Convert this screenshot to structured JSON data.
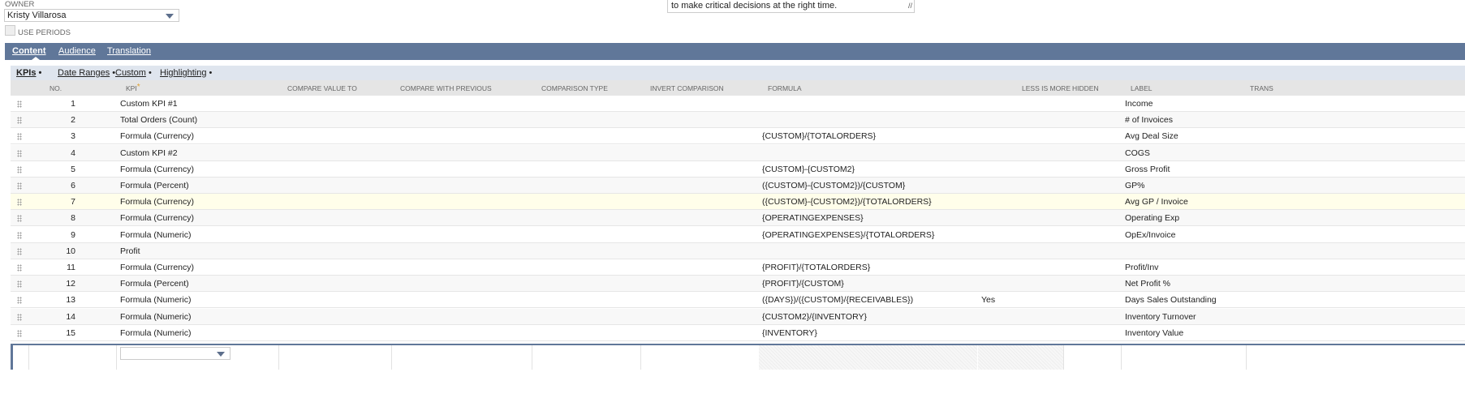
{
  "owner": {
    "label": "OWNER",
    "value": "Kristy Villarosa"
  },
  "use_periods": {
    "label": "USE PERIODS",
    "checked": false
  },
  "description": {
    "visible_text": "to make critical decisions at the right time."
  },
  "tabs": [
    {
      "label": "Content",
      "active": true
    },
    {
      "label": "Audience",
      "active": false
    },
    {
      "label": "Translation",
      "active": false
    }
  ],
  "subtabs": [
    {
      "label": "KPIs",
      "active": true
    },
    {
      "label": "Date Ranges",
      "active": false
    },
    {
      "label": "Custom",
      "active": false
    },
    {
      "label": "Highlighting",
      "active": false
    }
  ],
  "table": {
    "columns": {
      "no": "NO.",
      "kpi": "KPI",
      "kpi_required": "*",
      "compare_value_to": "COMPARE VALUE TO",
      "compare_with_previous": "COMPARE WITH PREVIOUS",
      "comparison_type": "COMPARISON TYPE",
      "invert_comparison": "INVERT COMPARISON",
      "formula": "FORMULA",
      "less_is_more": "LESS IS MORE",
      "hidden": "HIDDEN",
      "label": "LABEL",
      "trans": "TRANS"
    },
    "rows": [
      {
        "no": "1",
        "kpi": "Custom KPI #1",
        "formula": "",
        "less_is_more": "",
        "label": "Income"
      },
      {
        "no": "2",
        "kpi": "Total Orders (Count)",
        "formula": "",
        "less_is_more": "",
        "label": "# of Invoices"
      },
      {
        "no": "3",
        "kpi": "Formula (Currency)",
        "formula": "{CUSTOM}/{TOTALORDERS}",
        "less_is_more": "",
        "label": "Avg Deal Size"
      },
      {
        "no": "4",
        "kpi": "Custom KPI #2",
        "formula": "",
        "less_is_more": "",
        "label": "COGS"
      },
      {
        "no": "5",
        "kpi": "Formula (Currency)",
        "formula": "{CUSTOM}-{CUSTOM2}",
        "less_is_more": "",
        "label": "Gross Profit"
      },
      {
        "no": "6",
        "kpi": "Formula (Percent)",
        "formula": "({CUSTOM}-{CUSTOM2})/{CUSTOM}",
        "less_is_more": "",
        "label": "GP%"
      },
      {
        "no": "7",
        "kpi": "Formula (Currency)",
        "formula": "({CUSTOM}-{CUSTOM2})/{TOTALORDERS}",
        "less_is_more": "",
        "label": "Avg GP / Invoice"
      },
      {
        "no": "8",
        "kpi": "Formula (Currency)",
        "formula": "{OPERATINGEXPENSES}",
        "less_is_more": "",
        "label": "Operating Exp"
      },
      {
        "no": "9",
        "kpi": "Formula (Numeric)",
        "formula": "{OPERATINGEXPENSES}/{TOTALORDERS}",
        "less_is_more": "",
        "label": "OpEx/Invoice"
      },
      {
        "no": "10",
        "kpi": "Profit",
        "formula": "",
        "less_is_more": "",
        "label": ""
      },
      {
        "no": "11",
        "kpi": "Formula (Currency)",
        "formula": "{PROFIT}/{TOTALORDERS}",
        "less_is_more": "",
        "label": "Profit/Inv"
      },
      {
        "no": "12",
        "kpi": "Formula (Percent)",
        "formula": "{PROFIT}/{CUSTOM}",
        "less_is_more": "",
        "label": "Net Profit %"
      },
      {
        "no": "13",
        "kpi": "Formula (Numeric)",
        "formula": "({DAYS})/({CUSTOM}/{RECEIVABLES})",
        "less_is_more": "Yes",
        "label": "Days Sales Outstanding"
      },
      {
        "no": "14",
        "kpi": "Formula (Numeric)",
        "formula": "{CUSTOM2}/{INVENTORY}",
        "less_is_more": "",
        "label": "Inventory Turnover"
      },
      {
        "no": "15",
        "kpi": "Formula (Numeric)",
        "formula": "{INVENTORY}",
        "less_is_more": "",
        "label": "Inventory Value"
      }
    ],
    "highlighted_row": "7"
  },
  "colors": {
    "accent": "#607799",
    "subbar": "#dfe5ee",
    "header": "#e5e5e5",
    "highlight": "#fffeea"
  }
}
